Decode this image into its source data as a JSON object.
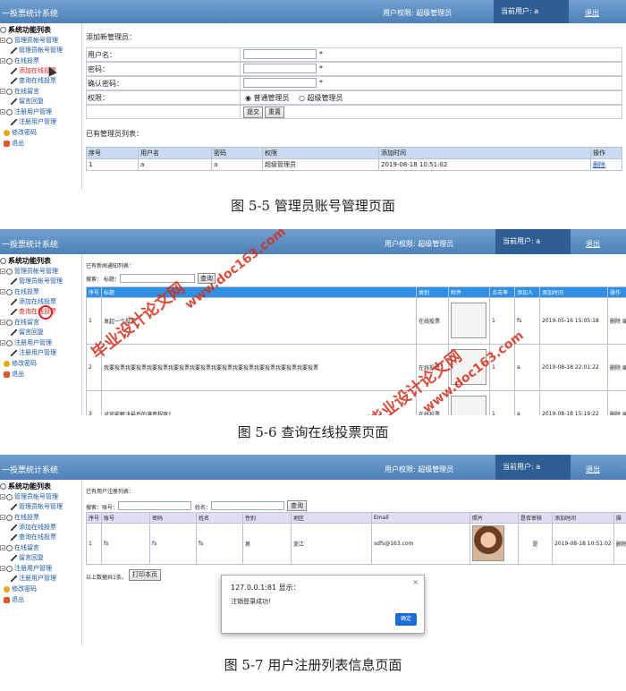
{
  "app": {
    "title": "一投票统计系统",
    "permission": "用户权限: 超级管理员",
    "current_user": "当前用户: a",
    "logout": "退出"
  },
  "sidebar": {
    "title": "系统功能列表",
    "items": [
      {
        "label": "管理员帐号管理",
        "level": 1
      },
      {
        "label": "管理员帐号管理",
        "level": 2
      },
      {
        "label": "在线投票",
        "level": 1
      },
      {
        "label": "添加在线投票",
        "level": 2
      },
      {
        "label": "查询在线投票",
        "level": 2
      },
      {
        "label": "在线留言",
        "level": 1
      },
      {
        "label": "留言回复",
        "level": 2
      },
      {
        "label": "注册用户管理",
        "level": 1
      },
      {
        "label": "注册用户管理",
        "level": 2
      },
      {
        "label": "修改密码",
        "level": 1
      },
      {
        "label": "退出",
        "level": 1
      }
    ]
  },
  "fig1": {
    "section_add": "添加新管理员：",
    "fields": [
      {
        "label": "用户名：",
        "required": "*"
      },
      {
        "label": "密码：",
        "required": "*"
      },
      {
        "label": "确认密码：",
        "required": "*"
      }
    ],
    "permission_label": "权限：",
    "radio_normal": "普通管理员",
    "radio_super": "超级管理员",
    "submit": "提交",
    "reset": "重置",
    "section_list": "已有管理员列表：",
    "headers": [
      "序号",
      "用户名",
      "密码",
      "权限",
      "添加时间",
      "操作"
    ],
    "rows": [
      [
        "1",
        "a",
        "a",
        "超级管理员",
        "2019-08-18 10:51:02",
        "删除"
      ]
    ],
    "caption": "图 5-5 管理员账号管理页面"
  },
  "fig2": {
    "section": "已有新闻通知列表：",
    "search_label": "搜索： 标题：",
    "search_btn": "查询",
    "headers": [
      "序号",
      "标题",
      "类别",
      "附件",
      "点击率",
      "添加人",
      "添加时间",
      "操作"
    ],
    "rows": [
      [
        "1",
        "发起一个投票",
        "在线投票",
        "",
        "1",
        "fs",
        "2019-05-16 15:05:18",
        "删除 编"
      ],
      [
        "2",
        "我要投票我要投票我要投票我要投票我要投票我要投票我要投票我要投票我要投票我要投票",
        "在线投票",
        "",
        "1",
        "a",
        "2019-08-18 22:01:22",
        "删除 编"
      ],
      [
        "3",
        "对官能解决最后的满意程度?",
        "在线投票",
        "",
        "1",
        "a",
        "2019-08-18 15:19:22",
        "删除 编"
      ]
    ],
    "caption": "图 5-6 查询在线投票页面",
    "watermark_1": "www.doc163.com",
    "watermark_2": "毕业设计论文网",
    "watermark_3": "毕业设计论文网",
    "watermark_4": "www.doc163.com"
  },
  "fig3": {
    "section": "已有用户注册列表：",
    "search_account": "搜索：账号：",
    "search_name": "姓名：",
    "search_btn": "查询",
    "headers": [
      "序号",
      "账号",
      "密码",
      "姓名",
      "性别",
      "地区",
      "Email",
      "照片",
      "是否审核",
      "添加时间",
      "操"
    ],
    "rows": [
      [
        "1",
        "fs",
        "fs",
        "fs",
        "男",
        "浙江",
        "sdfs@163.com",
        "",
        "是",
        "2019-08-18 10:51:02",
        "删除"
      ]
    ],
    "total_text": "以上数据共1条。",
    "print_btn": "打印本页",
    "dialog_title": "127.0.0.1:81 显示：",
    "dialog_msg": "注销登录成功！",
    "dialog_ok": "确定",
    "dialog_close": "×",
    "caption": "图 5-7 用户注册列表信息页面"
  }
}
